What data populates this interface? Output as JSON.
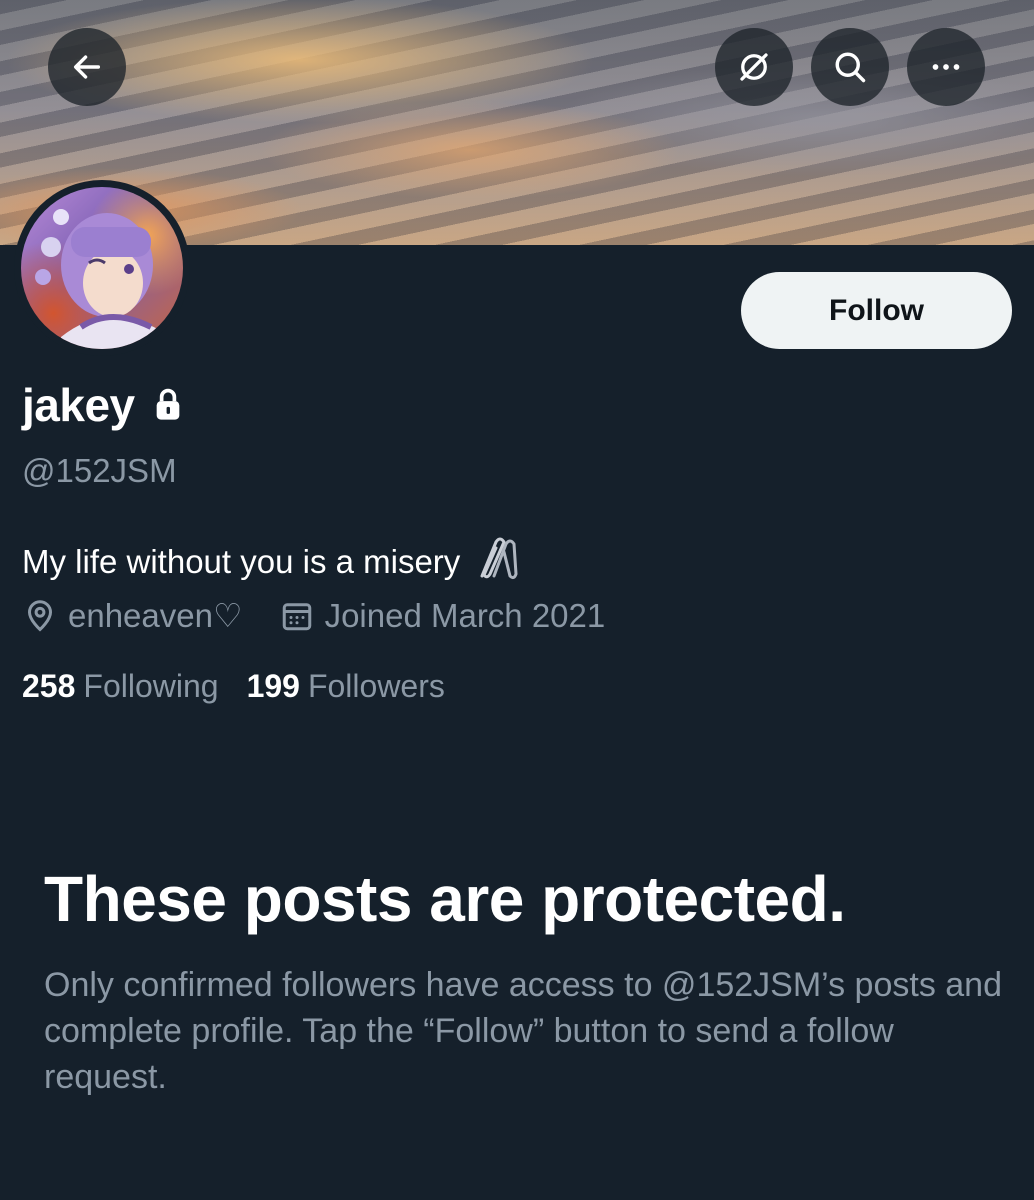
{
  "header": {
    "back_icon": "arrow-left-icon",
    "grok_icon": "grok-slash-icon",
    "search_icon": "search-icon",
    "more_icon": "more-horizontal-icon"
  },
  "profile": {
    "display_name": "jakey",
    "protected_icon": "lock-icon",
    "handle": "@152JSM",
    "bio": "My life without you is a misery",
    "bio_emoji": "paperclips-emoji",
    "location": "enheaven♡",
    "joined": "Joined March 2021",
    "following_count": "258",
    "following_label": "Following",
    "followers_count": "199",
    "followers_label": "Followers"
  },
  "actions": {
    "follow_label": "Follow"
  },
  "protected_notice": {
    "title": "These posts are protected.",
    "description": "Only confirmed followers have access to @152JSM’s posts and complete profile. Tap the “Follow” button to send a follow request."
  },
  "colors": {
    "background": "#15202b",
    "secondary_text": "#8b98a5",
    "follow_button_bg": "#eff3f4",
    "follow_button_text": "#0f1419"
  }
}
